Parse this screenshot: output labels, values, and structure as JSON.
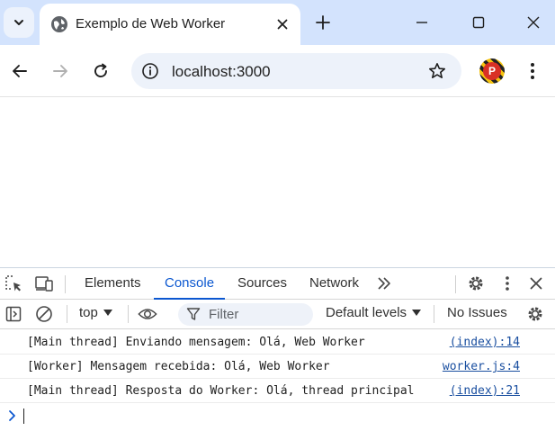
{
  "browser": {
    "tab": {
      "title": "Exemplo de Web Worker"
    },
    "address": {
      "url": "localhost:3000"
    },
    "profile_initial": "P"
  },
  "devtools": {
    "tabs": [
      {
        "label": "Elements"
      },
      {
        "label": "Console",
        "active": true
      },
      {
        "label": "Sources"
      },
      {
        "label": "Network"
      }
    ],
    "console_bar": {
      "context": "top",
      "filter_placeholder": "Filter",
      "levels": "Default levels",
      "issues": "No Issues"
    },
    "messages": [
      {
        "text": "[Main thread] Enviando mensagem: Olá, Web Worker",
        "source": "(index):14"
      },
      {
        "text": "[Worker] Mensagem recebida: Olá, Web Worker",
        "source": "worker.js:4"
      },
      {
        "text": "[Main thread] Resposta do Worker: Olá, thread principal",
        "source": "(index):21"
      }
    ]
  },
  "colors": {
    "tabstrip": "#d3e3fd",
    "accent": "#0b57d0",
    "link": "#1a4fa0"
  }
}
